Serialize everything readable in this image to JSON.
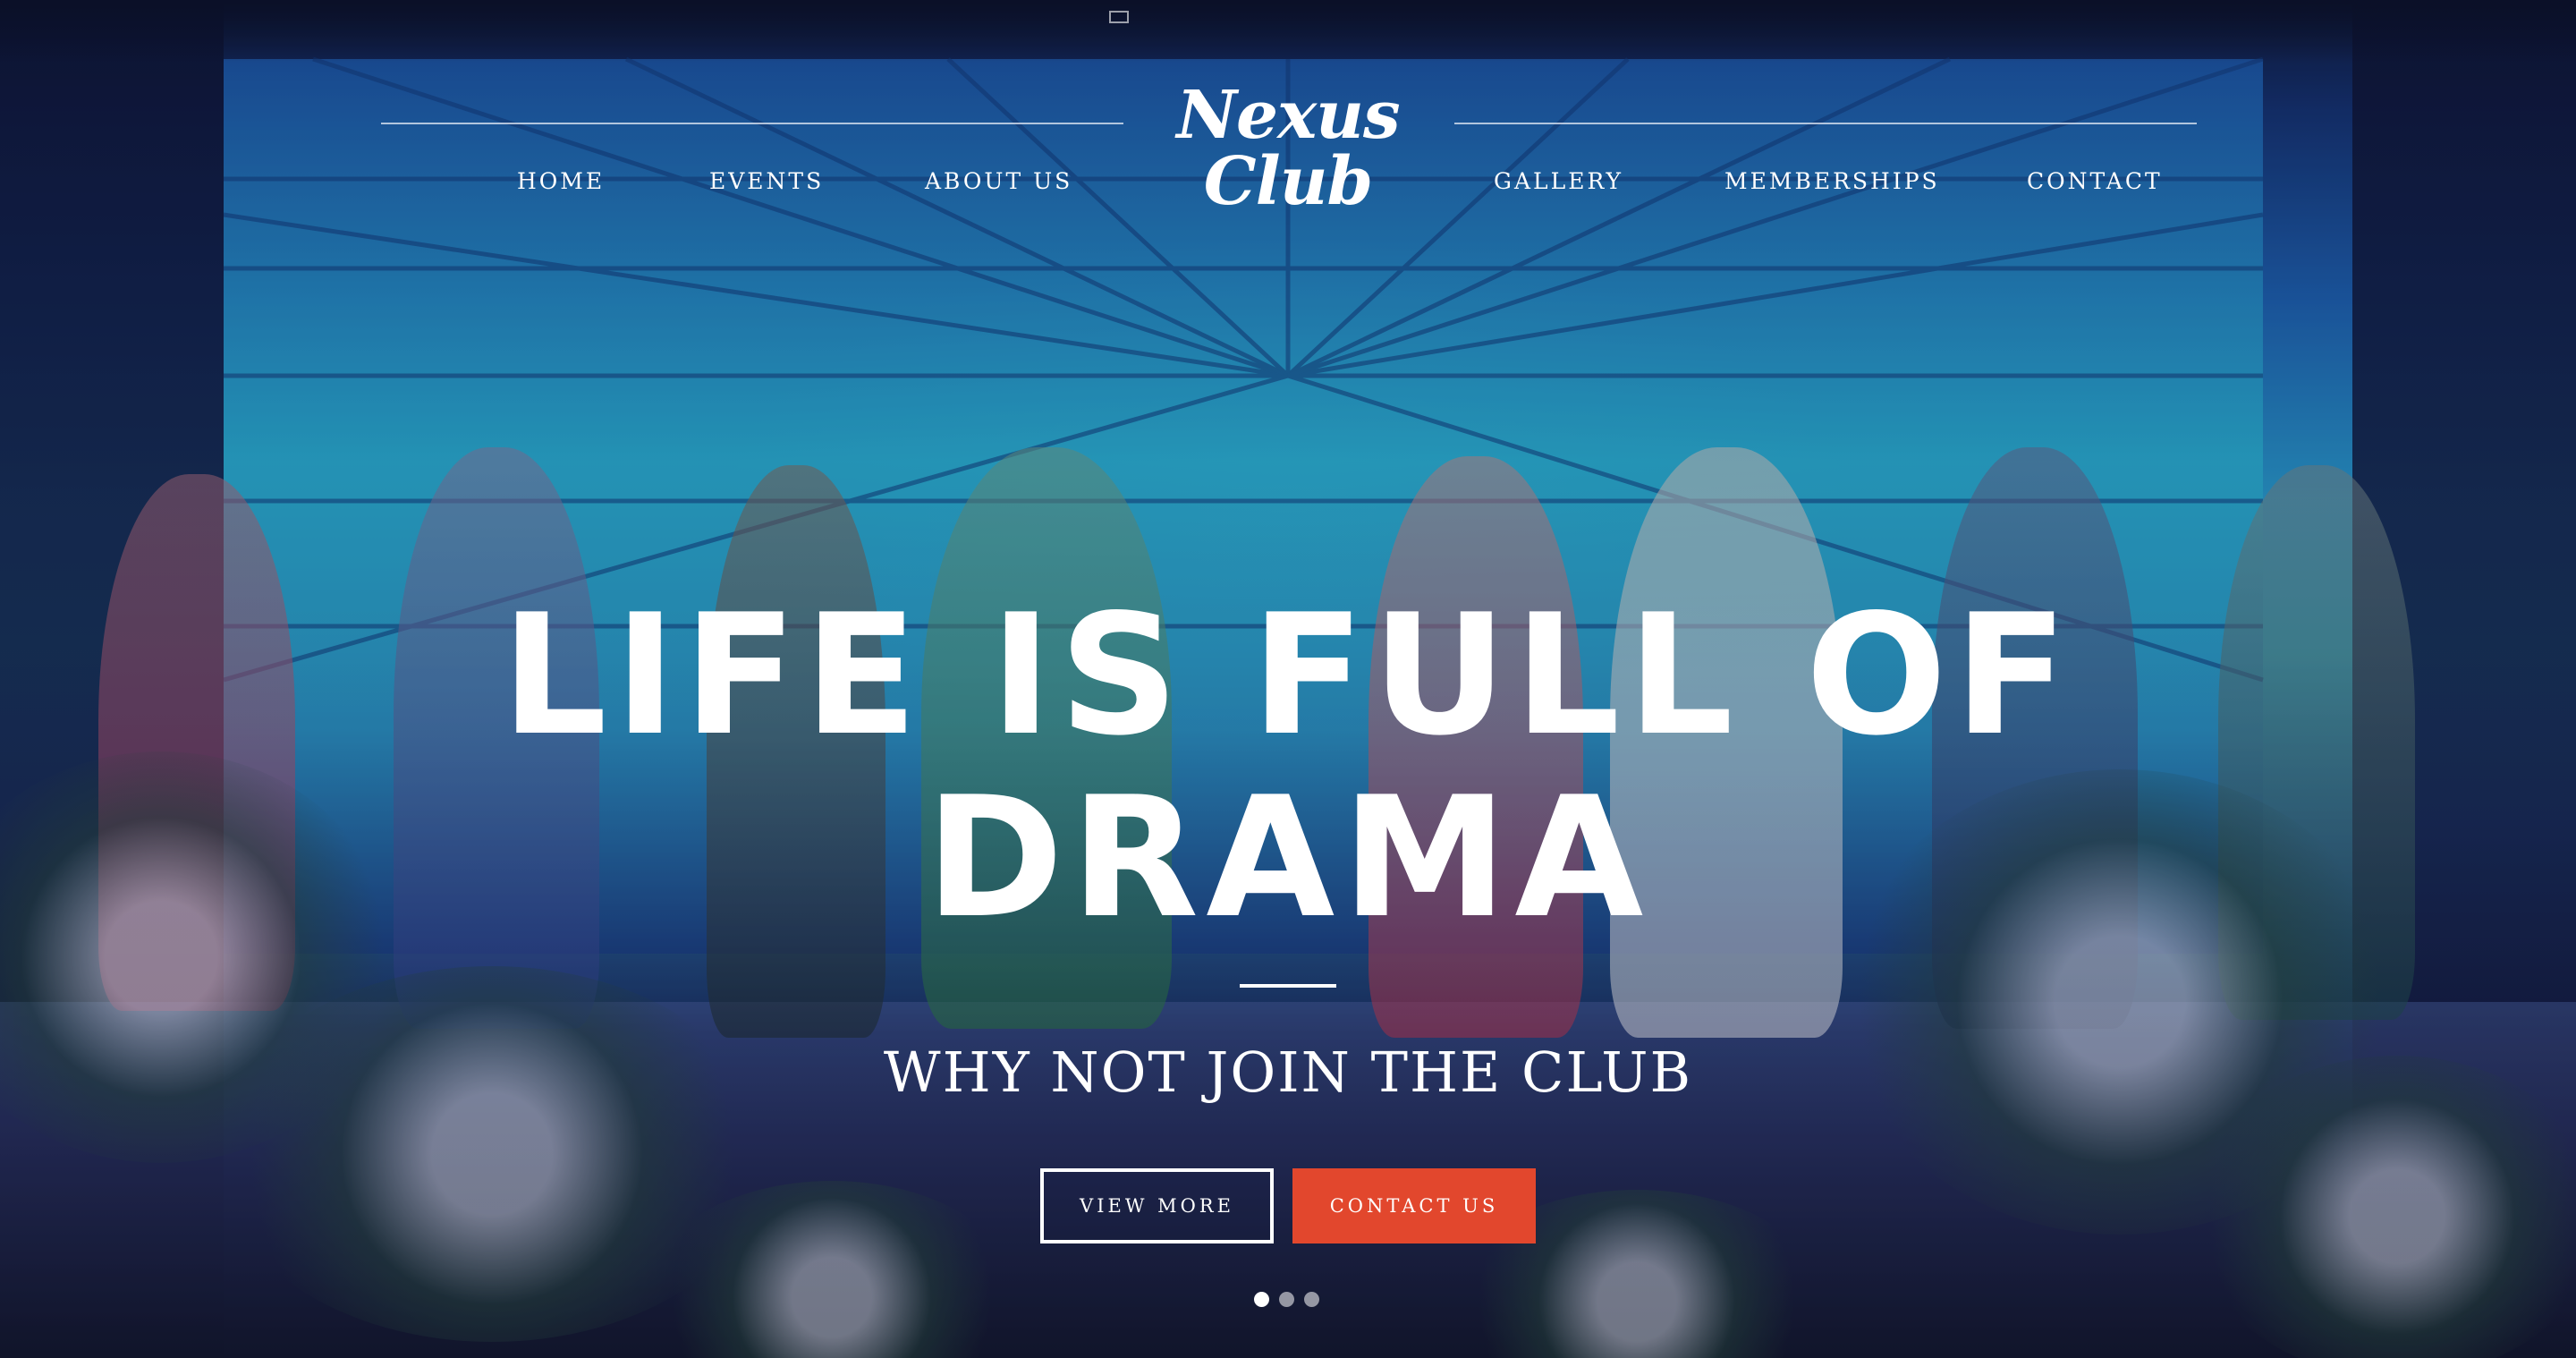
{
  "brand": {
    "name": "Nexus Club"
  },
  "nav": {
    "items": [
      {
        "label": "HOME"
      },
      {
        "label": "EVENTS"
      },
      {
        "label": "ABOUT US"
      },
      {
        "label": "GALLERY"
      },
      {
        "label": "MEMBERSHIPS"
      },
      {
        "label": "CONTACT"
      }
    ]
  },
  "hero": {
    "headline_line1": "LIFE IS FULL OF",
    "headline_line2": "DRAMA",
    "subtitle": "WHY NOT JOIN THE CLUB",
    "primary_button": "VIEW MORE",
    "secondary_button": "CONTACT US",
    "slider": {
      "slide_count": 3,
      "active_index": 0
    }
  },
  "colors": {
    "accent": "#e2472d",
    "text": "#ffffff"
  }
}
